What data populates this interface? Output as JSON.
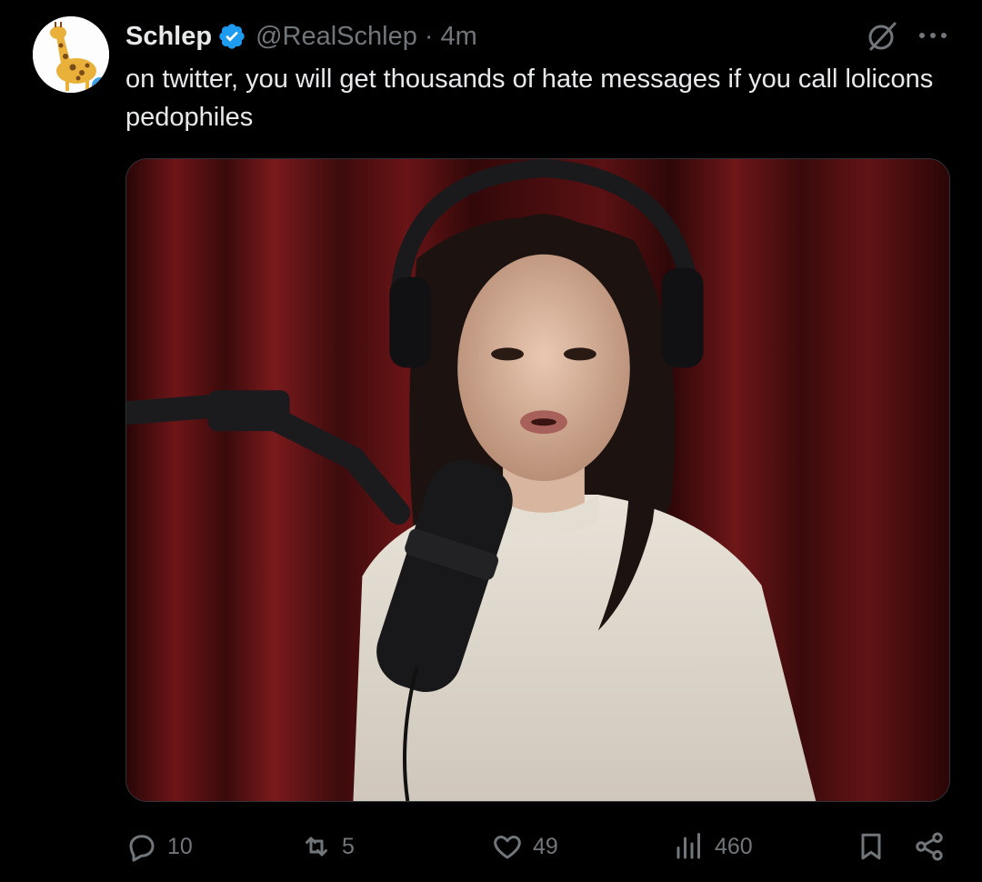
{
  "author": {
    "display_name": "Schlep",
    "handle": "@RealSchlep",
    "separator": "·",
    "time": "4m",
    "verified": true,
    "avatar_icon": "giraffe-avatar-icon"
  },
  "post": {
    "text": "on twitter, you will get thousands of hate messages if you call lolicons pedophiles",
    "media_icon": "podcast-photo"
  },
  "header_icons": {
    "grok": "grok-icon",
    "more": "more-options-icon"
  },
  "actions": {
    "replies": "10",
    "reposts": "5",
    "likes": "49",
    "views": "460"
  },
  "colors": {
    "background": "#000000",
    "text": "#e7e9ea",
    "muted": "#71767b",
    "verified": "#1d9bf0",
    "border": "#2f3336"
  }
}
